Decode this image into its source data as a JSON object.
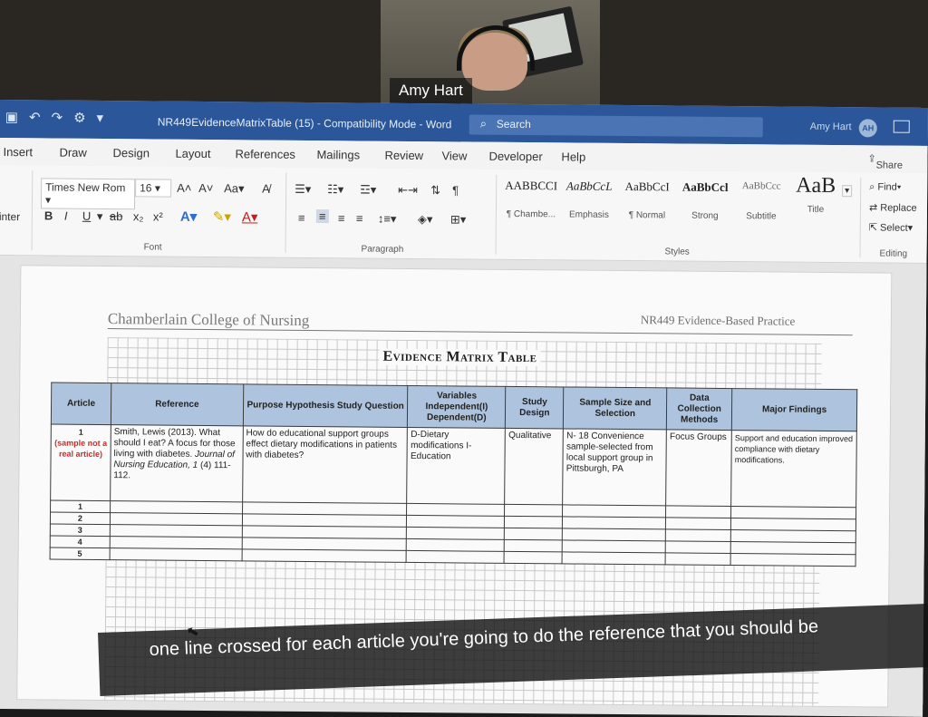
{
  "call": {
    "participant_name": "Amy Hart"
  },
  "titlebar": {
    "doc_title": "NR449EvidenceMatrixTable (15)  -  Compatibility Mode  -  Word",
    "search_placeholder": "Search",
    "user_name": "Amy Hart",
    "user_initials": "AH"
  },
  "tabs": [
    "Insert",
    "Draw",
    "Design",
    "Layout",
    "References",
    "Mailings",
    "Review",
    "View",
    "Developer",
    "Help"
  ],
  "share_label": "Share",
  "ribbon": {
    "clipboard_partial": "inter",
    "font_name": "Times New Rom",
    "font_size": "16",
    "case_label": "Aa",
    "font_group": "Font",
    "paragraph_group": "Paragraph",
    "styles_group": "Styles",
    "editing_group": "Editing",
    "styles": [
      {
        "preview": "AABBCCI",
        "name": "¶ Chambe..."
      },
      {
        "preview": "AaBbCcL",
        "name": "Emphasis"
      },
      {
        "preview": "AaBbCcI",
        "name": "¶ Normal"
      },
      {
        "preview": "AaBbCcl",
        "name": "Strong"
      },
      {
        "preview": "AaBbCcc",
        "name": "Subtitle"
      },
      {
        "preview": "AaB",
        "name": "Title"
      }
    ],
    "find_label": "Find",
    "replace_label": "Replace",
    "select_label": "Select"
  },
  "document": {
    "header_left": "Chamberlain College of Nursing",
    "header_right": "NR449 Evidence-Based Practice",
    "matrix_title": "Evidence Matrix Table",
    "columns": [
      "Article",
      "Reference",
      "Purpose Hypothesis Study Question",
      "Variables Independent(I) Dependent(D)",
      "Study Design",
      "Sample Size and Selection",
      "Data Collection Methods",
      "Major Findings"
    ],
    "sample_row": {
      "article_number": "1",
      "article_note": "(sample not a real article)",
      "reference_plain": "Smith, Lewis (2013). What should I eat? A focus for those living with diabetes.",
      "reference_journal": "Journal of Nursing Education, 1",
      "reference_pages": "(4) 111-112.",
      "purpose": "How do educational support groups effect dietary modifications in patients with diabetes?",
      "variables": "D-Dietary modifications I-Education",
      "design": "Qualitative",
      "sample": "N- 18 Convenience sample-selected from local support group in Pittsburgh, PA",
      "methods": "Focus Groups",
      "findings": "Support and education improved compliance with dietary modifications."
    },
    "blank_rows": [
      "1",
      "2",
      "3",
      "4",
      "5"
    ]
  },
  "caption": "one line crossed for each article you're going to do the reference that you should be"
}
